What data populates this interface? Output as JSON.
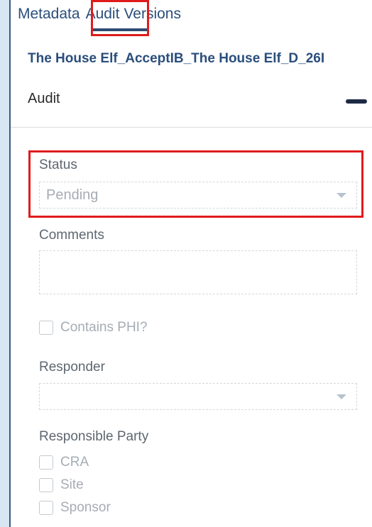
{
  "tabs": [
    {
      "label": "Metadata"
    },
    {
      "label": "Audit",
      "active": true
    },
    {
      "label": "Versions"
    }
  ],
  "document": {
    "title": "The House Elf_AcceptIB_The House Elf_D_26I"
  },
  "section": {
    "title": "Audit"
  },
  "fields": {
    "status": {
      "label": "Status",
      "value": "Pending"
    },
    "comments": {
      "label": "Comments",
      "value": ""
    },
    "contains_phi": {
      "label": "Contains PHI?",
      "checked": false
    },
    "responder": {
      "label": "Responder",
      "value": ""
    },
    "responsible_party": {
      "label": "Responsible Party",
      "options": [
        {
          "label": "CRA",
          "checked": false
        },
        {
          "label": "Site",
          "checked": false
        },
        {
          "label": "Sponsor",
          "checked": false
        }
      ]
    }
  },
  "colors": {
    "highlight": "#e01b1b",
    "accent": "#2a4e7c",
    "background": "#d7e6f2"
  }
}
